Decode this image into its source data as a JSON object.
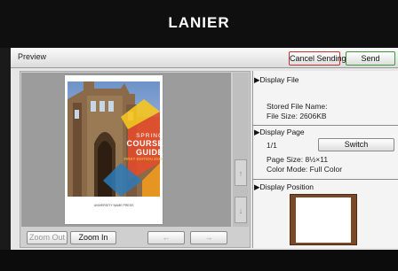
{
  "brand": "LANIER",
  "title": "Preview",
  "actions": {
    "cancel": "Cancel Sending",
    "send": "Send"
  },
  "cover": {
    "spring": "SPRING",
    "title": "COURSE GUIDE",
    "subtitle": "FIRST EDITION 20XX",
    "footer": "UNIVERSITY NAME PRESS"
  },
  "preview_controls": {
    "zoom_out": "Zoom Out",
    "zoom_in": "Zoom In",
    "prev": "←",
    "next": "→",
    "scroll_up": "↑",
    "scroll_down": "↓"
  },
  "display_file": {
    "header": "Display File",
    "stored_file_name": "Stored File Name:",
    "file_size": "File Size: 2606KB"
  },
  "display_page": {
    "header": "Display Page",
    "page": "1/1",
    "switch": "Switch",
    "page_size": "Page Size: 8½×11",
    "color_mode": "Color Mode: Full Color"
  },
  "display_position": {
    "header": "Display Position"
  },
  "colors": {
    "cancel_border": "#c23434",
    "send_border": "#3a9a3a"
  }
}
